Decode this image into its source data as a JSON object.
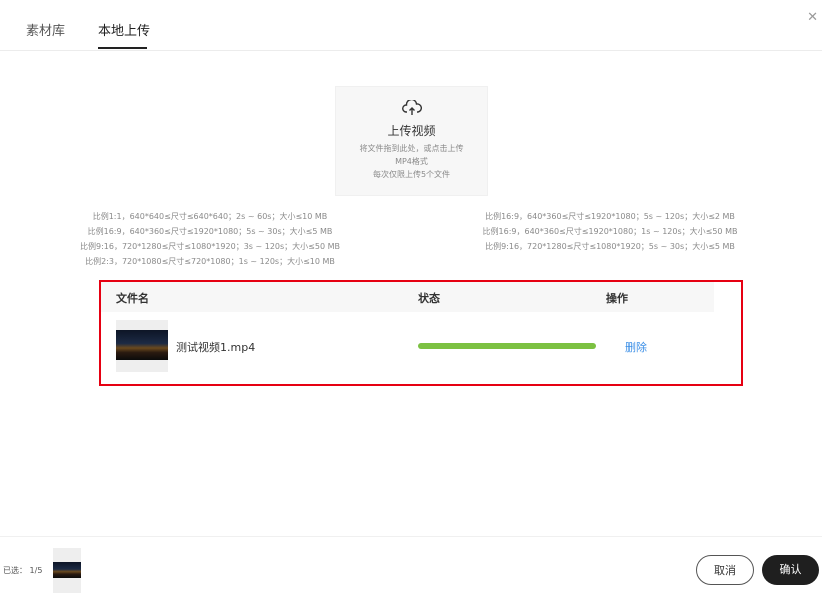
{
  "tabs": [
    {
      "label": "素材库"
    },
    {
      "label": "本地上传"
    }
  ],
  "close_icon": "close-icon",
  "upload": {
    "icon": "cloud-upload-icon",
    "title": "上传视频",
    "line1": "将文件拖到此处，或点击上传",
    "line2": "MP4格式",
    "line3": "每次仅限上传5个文件"
  },
  "specs_left": [
    "比例1:1，640*640≤尺寸≤640*640；2s ~ 60s；大小≤10 MB",
    "比例16:9，640*360≤尺寸≤1920*1080；5s ~ 30s；大小≤5 MB",
    "比例9:16，720*1280≤尺寸≤1080*1920；3s ~ 120s；大小≤50 MB",
    "比例2:3，720*1080≤尺寸≤720*1080；1s ~ 120s；大小≤10 MB"
  ],
  "specs_right": [
    "比例16:9，640*360≤尺寸≤1920*1080；5s ~ 120s；大小≤2 MB",
    "比例16:9，640*360≤尺寸≤1920*1080；1s ~ 120s；大小≤50 MB",
    "比例9:16，720*1280≤尺寸≤1080*1920；5s ~ 30s；大小≤5 MB"
  ],
  "table": {
    "col_name": "文件名",
    "col_status": "状态",
    "col_action": "操作",
    "rows": [
      {
        "filename": "测试视频1.mp4",
        "progress": 1.0,
        "action": "删除"
      }
    ]
  },
  "colors": {
    "progress": "#7cc142",
    "highlight_border": "#e60012",
    "link": "#3a8ee6"
  },
  "footer": {
    "selected_label": "已选：",
    "selected_count": "1/5",
    "cancel": "取消",
    "confirm": "确认"
  }
}
